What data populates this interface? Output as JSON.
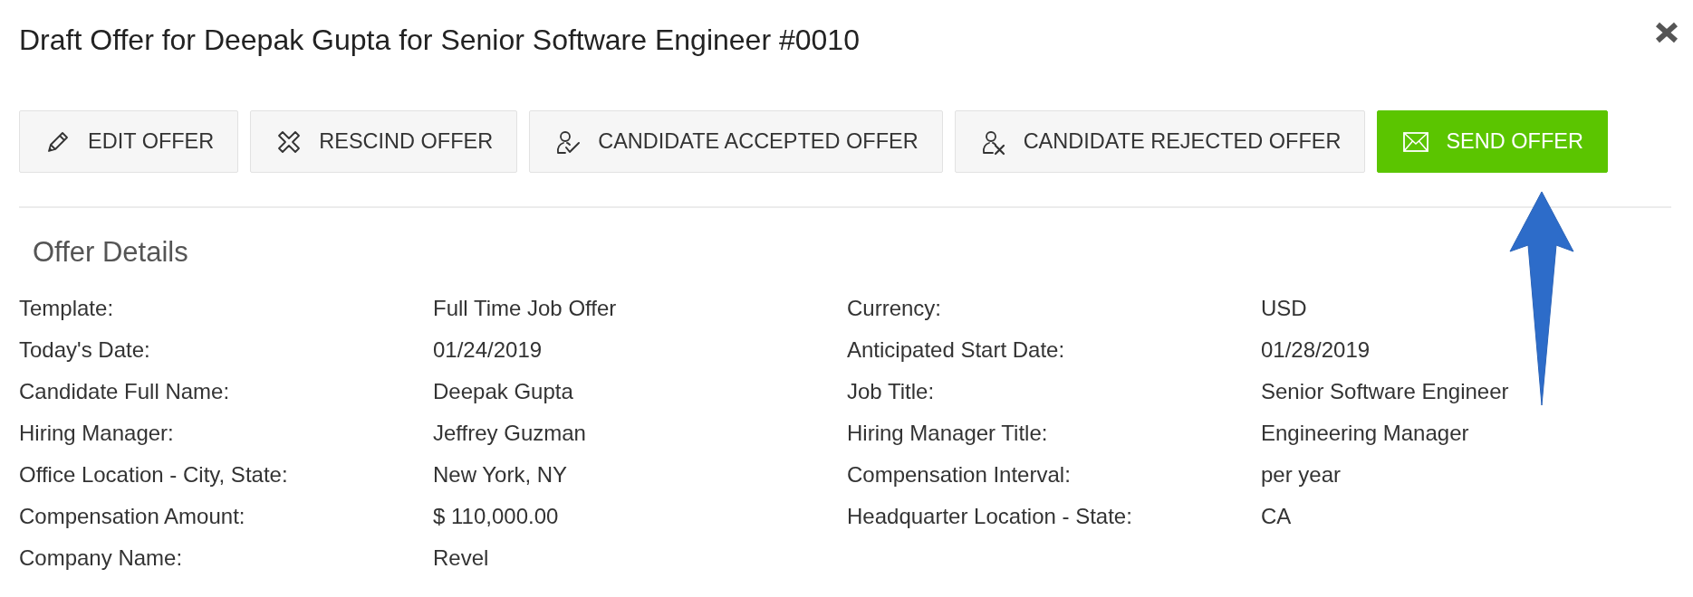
{
  "dialog": {
    "title": "Draft Offer for Deepak Gupta for Senior Software Engineer #0010"
  },
  "actions": [
    {
      "label": "EDIT OFFER",
      "kind": "edit",
      "primary": false
    },
    {
      "label": "RESCIND OFFER",
      "kind": "rescind",
      "primary": false
    },
    {
      "label": "CANDIDATE ACCEPTED OFFER",
      "kind": "accepted",
      "primary": false
    },
    {
      "label": "CANDIDATE REJECTED OFFER",
      "kind": "rejected",
      "primary": false
    },
    {
      "label": "SEND OFFER",
      "kind": "send",
      "primary": true
    }
  ],
  "offer_details": {
    "heading": "Offer Details",
    "columns": [
      {
        "fields": [
          {
            "label": "Template:",
            "value": "Full Time Job Offer"
          },
          {
            "label": "Today's Date:",
            "value": "01/24/2019"
          },
          {
            "label": "Candidate Full Name:",
            "value": "Deepak Gupta"
          },
          {
            "label": "Hiring Manager:",
            "value": "Jeffrey Guzman"
          },
          {
            "label": "Office Location - City, State:",
            "value": "New York, NY"
          },
          {
            "label": "Compensation Amount:",
            "value": "$ 110,000.00"
          },
          {
            "label": "Company Name:",
            "value": "Revel"
          }
        ]
      },
      {
        "fields": [
          {
            "label": "Currency:",
            "value": "USD"
          },
          {
            "label": "Anticipated Start Date:",
            "value": "01/28/2019"
          },
          {
            "label": "Job Title:",
            "value": "Senior Software Engineer"
          },
          {
            "label": "Hiring Manager Title:",
            "value": "Engineering Manager"
          },
          {
            "label": "Compensation Interval:",
            "value": "per year"
          },
          {
            "label": "Headquarter Location - State:",
            "value": "CA"
          }
        ]
      }
    ]
  }
}
